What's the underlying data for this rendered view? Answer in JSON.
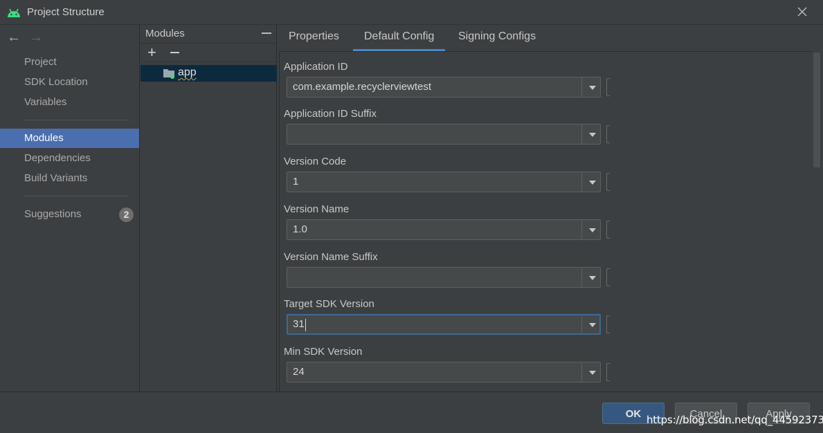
{
  "window": {
    "title": "Project Structure",
    "icon": "android-icon"
  },
  "sidebar": {
    "items": [
      {
        "label": "Project"
      },
      {
        "label": "SDK Location"
      },
      {
        "label": "Variables"
      },
      {
        "label": "Modules",
        "selected": true
      },
      {
        "label": "Dependencies"
      },
      {
        "label": "Build Variants"
      },
      {
        "label": "Suggestions",
        "badge": "2"
      }
    ]
  },
  "modules_panel": {
    "title": "Modules",
    "add_icon": "+",
    "selected_module": "app"
  },
  "tabs": [
    {
      "label": "Properties"
    },
    {
      "label": "Default Config",
      "active": true
    },
    {
      "label": "Signing Configs"
    }
  ],
  "form": {
    "fields": [
      {
        "label": "Application ID",
        "value": "com.example.recyclerviewtest"
      },
      {
        "label": "Application ID Suffix",
        "value": ""
      },
      {
        "label": "Version Code",
        "value": "1"
      },
      {
        "label": "Version Name",
        "value": "1.0"
      },
      {
        "label": "Version Name Suffix",
        "value": ""
      },
      {
        "label": "Target SDK Version",
        "value": "31",
        "focused": true
      },
      {
        "label": "Min SDK Version",
        "value": "24"
      }
    ]
  },
  "buttons": {
    "ok": "OK",
    "cancel": "Cancel",
    "apply": "Apply"
  },
  "watermark": "https://blog.csdn.net/qq_44592373",
  "colors": {
    "background": "#3c3f41",
    "selection": "#4b6eaf",
    "module_selection": "#0d293e",
    "tab_underline": "#4a88c7",
    "ok_button": "#365880"
  }
}
